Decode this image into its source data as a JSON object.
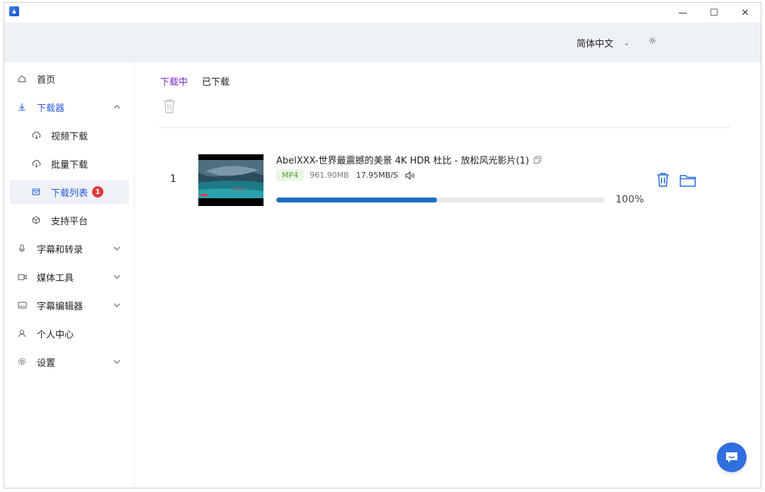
{
  "window_controls": {
    "minimize": "—",
    "maximize": "☐",
    "close": "✕"
  },
  "header": {
    "language": "简体中文",
    "language_chevron": "⌄",
    "theme_icon": "☼"
  },
  "sidebar": {
    "items": [
      {
        "label": "首页",
        "icon": "home-icon"
      },
      {
        "label": "下载器",
        "icon": "download-icon",
        "arrow": "^"
      },
      {
        "label": "视频下载",
        "icon": "cloud-download-icon"
      },
      {
        "label": "批量下载",
        "icon": "cloud-download-icon"
      },
      {
        "label": "下载列表",
        "icon": "list-icon",
        "badge": "1"
      },
      {
        "label": "支持平台",
        "icon": "cube-icon"
      },
      {
        "label": "字幕和转录",
        "icon": "mic-icon",
        "arrow": "v"
      },
      {
        "label": "媒体工具",
        "icon": "video-icon",
        "arrow": "v"
      },
      {
        "label": "字幕编辑器",
        "icon": "subtitle-icon",
        "arrow": "v"
      },
      {
        "label": "个人中心",
        "icon": "user-icon"
      },
      {
        "label": "设置",
        "icon": "gear-icon",
        "arrow": "v"
      }
    ]
  },
  "main": {
    "tabs": [
      {
        "label": "下载中"
      },
      {
        "label": "已下载"
      }
    ],
    "downloads": [
      {
        "index": "1",
        "title": "AbelXXX-世界最震撼的美景 4K HDR 杜比 - 放松风光影片(1)",
        "format": "MP4",
        "size": "961.90MB",
        "speed": "17.95MB/S",
        "progress_text": "100%",
        "progress_fill": 0.49
      }
    ]
  },
  "colors": {
    "accent": "#2a5bd7",
    "active_tab": "#7b2ad1",
    "progress": "#1f6fc5",
    "badge": "#e03b3b"
  }
}
